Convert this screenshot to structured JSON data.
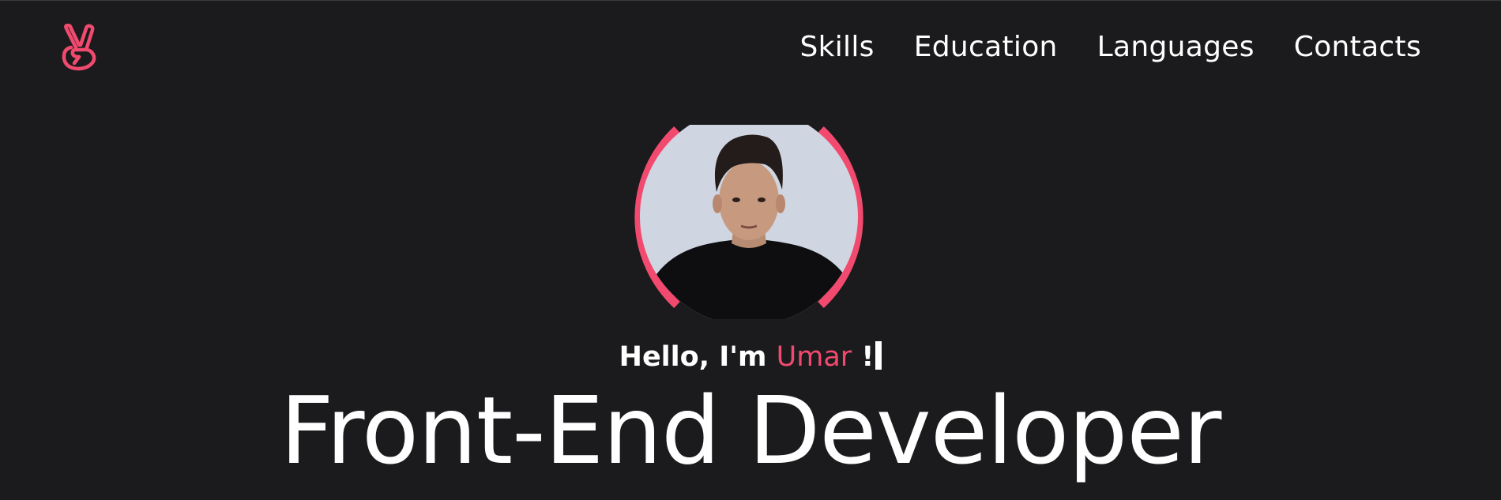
{
  "colors": {
    "background": "#1b1b1d",
    "accent": "#f24a6f",
    "text": "#ffffff"
  },
  "header": {
    "logo_icon": "peace-hand-icon",
    "nav": [
      "Skills",
      "Education",
      "Languages",
      "Contacts"
    ]
  },
  "hero": {
    "avatar_icon": "profile-photo",
    "greeting_prefix": "Hello, I'm",
    "name": "Umar",
    "greeting_suffix": "!",
    "title": "Front-End Developer"
  }
}
